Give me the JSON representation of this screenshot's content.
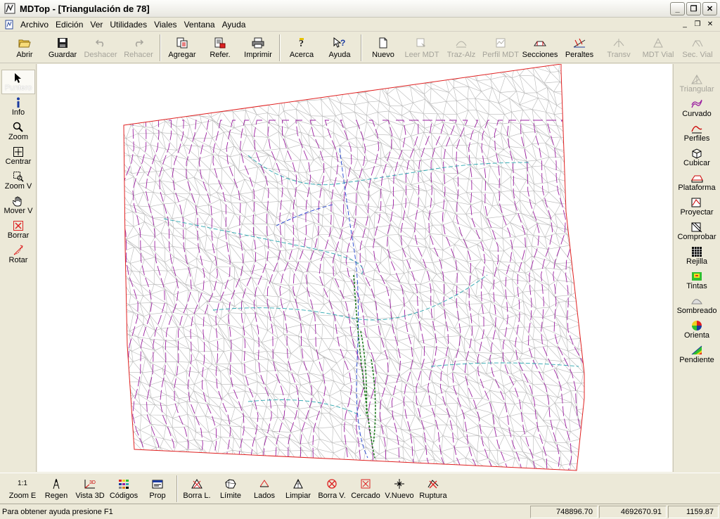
{
  "window": {
    "title": "MDTop - [Triangulación de 78]",
    "minimize": "_",
    "maximize": "❐",
    "close": "✕"
  },
  "menu": {
    "items": [
      "Archivo",
      "Edición",
      "Ver",
      "Utilidades",
      "Viales",
      "Ventana",
      "Ayuda"
    ],
    "mdi_min": "_",
    "mdi_restore": "❐",
    "mdi_close": "✕"
  },
  "toolbar": {
    "buttons": [
      {
        "label": "Abrir",
        "icon": "folder-open-icon",
        "enabled": true
      },
      {
        "label": "Guardar",
        "icon": "floppy-disk-icon",
        "enabled": true
      },
      {
        "label": "Deshacer",
        "icon": "undo-icon",
        "enabled": false
      },
      {
        "label": "Rehacer",
        "icon": "redo-icon",
        "enabled": false
      },
      {
        "label": "Agregar",
        "icon": "add-file-icon",
        "enabled": true
      },
      {
        "label": "Refer.",
        "icon": "reference-icon",
        "enabled": true
      },
      {
        "label": "Imprimir",
        "icon": "printer-icon",
        "enabled": true
      },
      {
        "label": "Acerca",
        "icon": "about-icon",
        "enabled": true
      },
      {
        "label": "Ayuda",
        "icon": "help-icon",
        "enabled": true
      },
      {
        "label": "Nuevo",
        "icon": "new-doc-icon",
        "enabled": true
      },
      {
        "label": "Leer MDT",
        "icon": "read-mdt-icon",
        "enabled": false
      },
      {
        "label": "Traz-Alz",
        "icon": "traz-alz-icon",
        "enabled": false
      },
      {
        "label": "Perfil MDT",
        "icon": "profile-mdt-icon",
        "enabled": false
      },
      {
        "label": "Secciones",
        "icon": "sections-icon",
        "enabled": true
      },
      {
        "label": "Peraltes",
        "icon": "peraltes-icon",
        "enabled": true
      },
      {
        "label": "Transv",
        "icon": "transv-icon",
        "enabled": false
      },
      {
        "label": "MDT Vial",
        "icon": "mdt-vial-icon",
        "enabled": false
      },
      {
        "label": "Sec. Vial",
        "icon": "sec-vial-icon",
        "enabled": false
      }
    ]
  },
  "left_toolbar": {
    "buttons": [
      {
        "label": "Puntero",
        "icon": "pointer-icon",
        "active": true
      },
      {
        "label": "Info",
        "icon": "info-icon",
        "active": false
      },
      {
        "label": "Zoom",
        "icon": "magnifier-icon",
        "active": false
      },
      {
        "label": "Centrar",
        "icon": "center-icon",
        "active": false
      },
      {
        "label": "Zoom V",
        "icon": "zoom-window-icon",
        "active": false
      },
      {
        "label": "Mover V",
        "icon": "hand-icon",
        "active": false
      },
      {
        "label": "Borrar",
        "icon": "delete-icon",
        "active": false
      },
      {
        "label": "Rotar",
        "icon": "rotate-icon",
        "active": false
      }
    ]
  },
  "right_toolbar": {
    "buttons": [
      {
        "label": "Triangular",
        "icon": "triangulate-icon",
        "enabled": false
      },
      {
        "label": "Curvado",
        "icon": "contour-icon",
        "enabled": true
      },
      {
        "label": "Perfiles",
        "icon": "profiles-icon",
        "enabled": true
      },
      {
        "label": "Cubicar",
        "icon": "cube-icon",
        "enabled": true
      },
      {
        "label": "Plataforma",
        "icon": "platform-icon",
        "enabled": true
      },
      {
        "label": "Proyectar",
        "icon": "project-icon",
        "enabled": true
      },
      {
        "label": "Comprobar",
        "icon": "check-icon",
        "enabled": true
      },
      {
        "label": "Rejilla",
        "icon": "grid-icon",
        "enabled": true
      },
      {
        "label": "Tintas",
        "icon": "tints-icon",
        "enabled": true
      },
      {
        "label": "Sombreado",
        "icon": "shading-icon",
        "enabled": true
      },
      {
        "label": "Orienta",
        "icon": "orientation-wheel-icon",
        "enabled": true
      },
      {
        "label": "Pendiente",
        "icon": "slope-icon",
        "enabled": true
      }
    ]
  },
  "bottom_toolbar": {
    "buttons": [
      {
        "label": "Zoom E",
        "icon_text": "1:1",
        "icon": "zoom-extents-icon"
      },
      {
        "label": "Regen",
        "icon": "regen-icon"
      },
      {
        "label": "Vista 3D",
        "icon": "view-3d-icon"
      },
      {
        "label": "Códigos",
        "icon": "codes-icon"
      },
      {
        "label": "Prop",
        "icon": "properties-icon"
      },
      {
        "label": "Borra L.",
        "icon": "delete-line-icon"
      },
      {
        "label": "Límite",
        "icon": "limit-icon"
      },
      {
        "label": "Lados",
        "icon": "sides-icon"
      },
      {
        "label": "Limpiar",
        "icon": "clean-icon"
      },
      {
        "label": "Borra V.",
        "icon": "delete-vertex-icon"
      },
      {
        "label": "Cercado",
        "icon": "fence-icon"
      },
      {
        "label": "V.Nuevo",
        "icon": "new-vertex-icon"
      },
      {
        "label": "Ruptura",
        "icon": "breakline-icon"
      }
    ]
  },
  "status": {
    "message": "Para obtener ayuda presione F1",
    "x": "748896.70",
    "y": "4692670.91",
    "z": "1159.87"
  },
  "colors": {
    "contour_major": "#9b1fa0",
    "triangle_mesh": "#b8b8b8",
    "boundary": "#e02020",
    "breakline_green": "#1e7a1e",
    "breakline_cyan": "#2aa7b0",
    "breakline_blue": "#2040d0"
  }
}
